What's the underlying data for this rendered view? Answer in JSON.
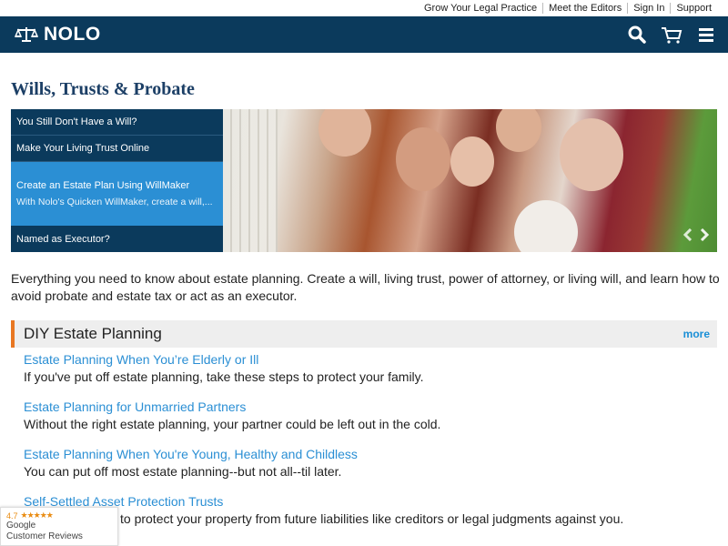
{
  "utility_links": [
    "Grow Your Legal Practice",
    "Meet the Editors",
    "Sign In",
    "Support"
  ],
  "header": {
    "logo_text": "NOLO",
    "icons": [
      "search-icon",
      "cart-icon",
      "menu-icon"
    ]
  },
  "page_title": "Wills, Trusts & Probate",
  "hero": {
    "items": [
      {
        "title": "You Still Don't Have a Will?"
      },
      {
        "title": "Make Your Living Trust Online"
      },
      {
        "title": "Create an Estate Plan Using WillMaker",
        "subtitle": "With Nolo's Quicken WillMaker, create a will,..."
      },
      {
        "title": "Named as Executor?"
      }
    ]
  },
  "intro": "Everything you need to know about estate planning. Create a will, living trust, power of attorney, or living will, and learn how to avoid probate and estate tax or act as an executor.",
  "section": {
    "title": "DIY Estate Planning",
    "more": "more",
    "articles": [
      {
        "link": "Estate Planning When You’re Elderly or Ill",
        "desc": "If you've put off estate planning, take these steps to protect your family."
      },
      {
        "link": "Estate Planning for Unmarried Partners",
        "desc": "Without the right estate planning, your partner could be left out in the cold."
      },
      {
        "link": "Estate Planning When You're Young, Healthy and Childless",
        "desc": "You can put off most estate planning--but not all--til later."
      },
      {
        "link": "Self-Settled Asset Protection Trusts",
        "desc": "to protect your property from future liabilities like creditors or legal judgments against you."
      }
    ]
  },
  "badge": {
    "rating": "4.7",
    "stars": "★★★★★",
    "brand": "Google",
    "label": "Customer Reviews"
  },
  "colors": {
    "navy": "#0b3a5c",
    "blue_active": "#2b8fd4",
    "orange_accent": "#e87722",
    "link": "#2b8fd4"
  }
}
